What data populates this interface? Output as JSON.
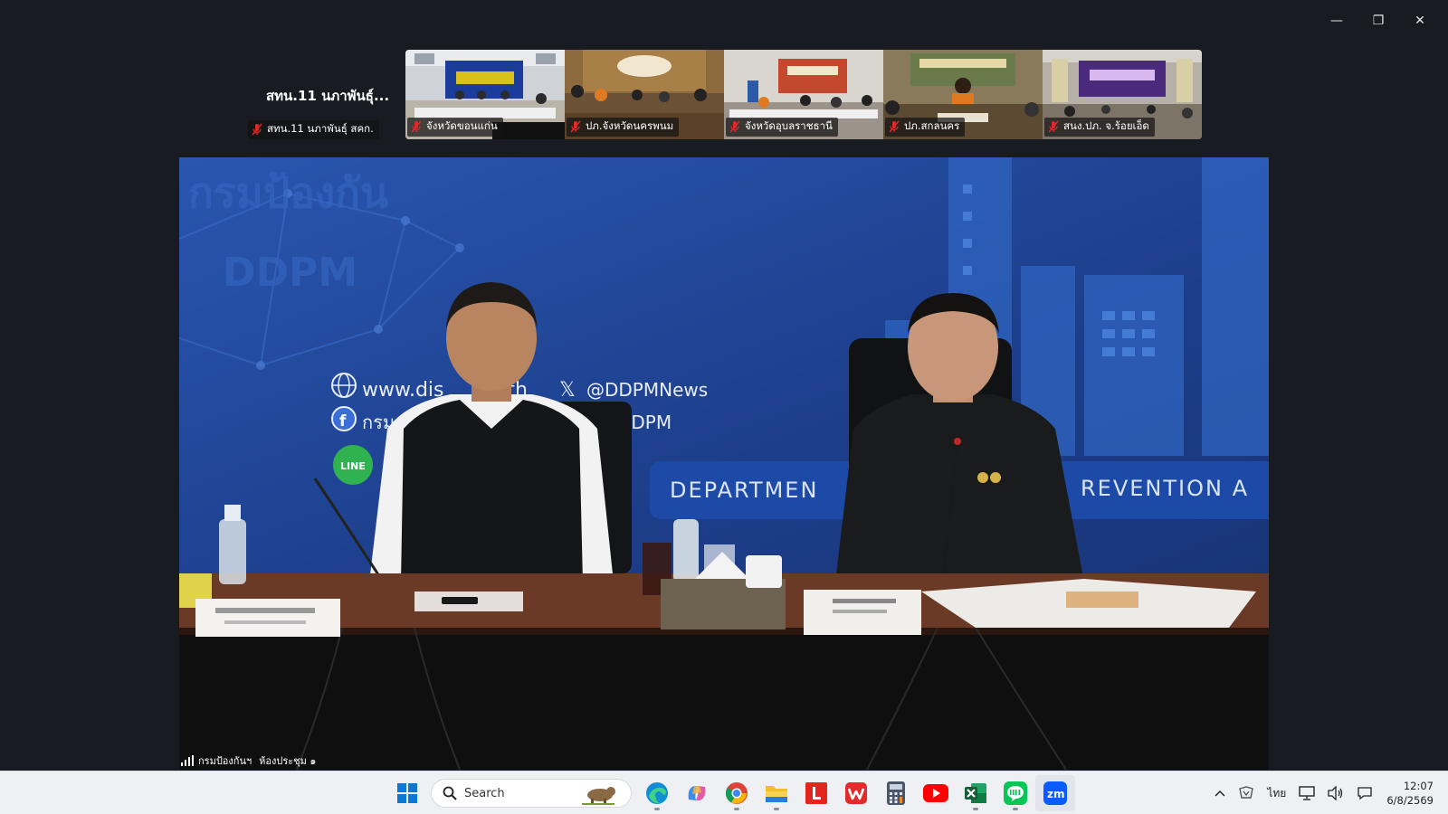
{
  "window": {
    "minimize": "—",
    "restore": "❐",
    "close": "✕"
  },
  "self_view": {
    "name": "สทน.11 นภาพันธุ์...",
    "label": "สทน.11 นภาพันธุ์ สคก."
  },
  "participants": [
    {
      "label": "จังหวัดขอนแก่น",
      "muted": true
    },
    {
      "label": "ปภ.จังหวัดนครพนม",
      "muted": true
    },
    {
      "label": "จังหวัดอุบลราชธานี",
      "muted": true
    },
    {
      "label": "ปภ.สกลนคร",
      "muted": true
    },
    {
      "label": "สนง.ปภ. จ.ร้อยเอ็ด",
      "muted": true
    }
  ],
  "main_video": {
    "speaker_name": "กรมป้องกันฯ",
    "room": "ห้องประชุม ๑",
    "backdrop": {
      "watermark_thai": "กรมป้องกัน",
      "watermark_en": "DDPM",
      "website": "www.dis         .th",
      "twitter": "@DDPMNews",
      "facebook": "กรม",
      "facebook_suffix": "DDPM",
      "banner_left": "DEPARTMEN",
      "banner_right": "REVENTION A",
      "line": "LINE"
    }
  },
  "taskbar": {
    "search_placeholder": "Search",
    "apps": [
      "edge-icon",
      "copilot-icon",
      "chrome-icon",
      "file-explorer-icon",
      "l-app-icon",
      "wps-icon",
      "calculator-icon",
      "youtube-icon",
      "excel-icon",
      "line-icon",
      "zoom-icon"
    ],
    "zoom_label": "zm",
    "language": "ไทย",
    "time": "12:07",
    "date": "6/8/2569"
  },
  "colors": {
    "backdrop_blue": "#1d3f8c",
    "zoom_blue": "#0b5cff",
    "mute_red": "#e02828"
  }
}
